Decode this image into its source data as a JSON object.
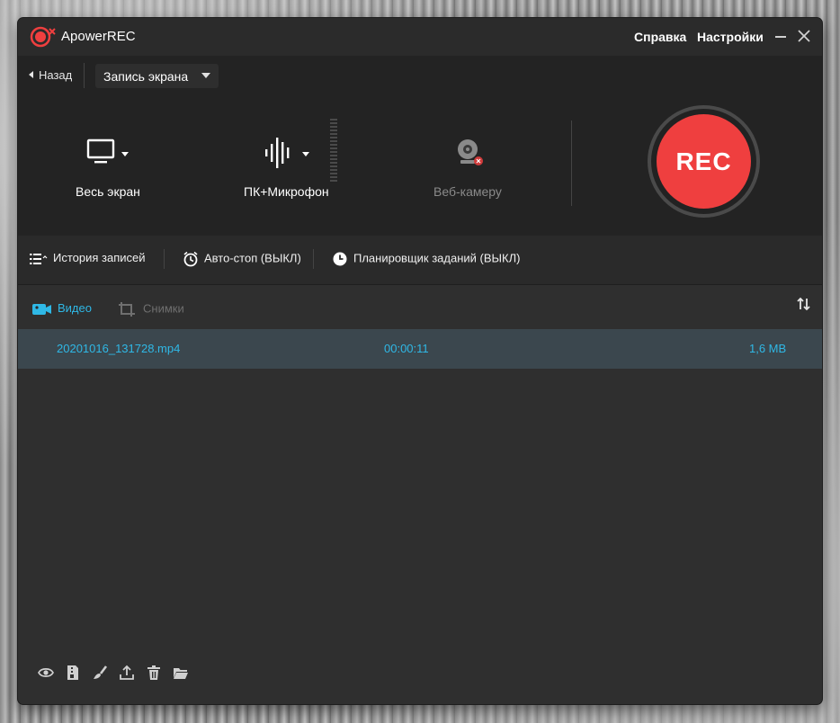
{
  "app": {
    "title": "ApowerREC"
  },
  "titlebar": {
    "help": "Справка",
    "settings": "Настройки"
  },
  "top": {
    "back": "Назад",
    "mode": "Запись экрана",
    "sources": [
      {
        "label": "Весь экран",
        "icon": "monitor-icon",
        "enabled": true
      },
      {
        "label": "ПК+Микрофон",
        "icon": "sound-wave-icon",
        "enabled": true
      },
      {
        "label": "Веб-камеру",
        "icon": "webcam-icon",
        "enabled": false
      }
    ],
    "rec_label": "REC"
  },
  "tools": {
    "history": "История записей",
    "autostop": "Авто-стоп (ВЫКЛ)",
    "scheduler": "Планировщик заданий (ВЫКЛ)"
  },
  "tabs": {
    "video": "Видео",
    "screenshots": "Снимки"
  },
  "files": [
    {
      "name": "20201016_131728.mp4",
      "duration": "00:00:11",
      "size": "1,6 MB"
    }
  ],
  "bottom_icons": [
    "eye-icon",
    "compress-icon",
    "edit-icon",
    "upload-icon",
    "trash-icon",
    "folder-icon"
  ],
  "colors": {
    "accent": "#2fb8e6",
    "rec": "#ef3f3f",
    "row_selected": "#3b474e"
  }
}
